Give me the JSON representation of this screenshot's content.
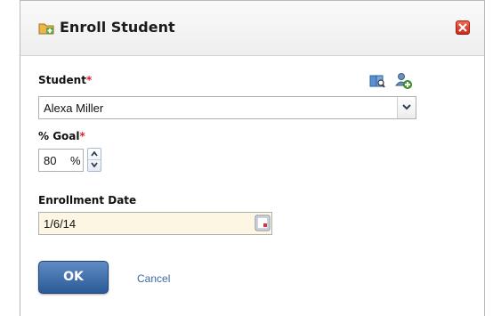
{
  "dialog": {
    "title": "Enroll Student",
    "title_icon": "enroll-folder-icon",
    "close_icon": "close-icon"
  },
  "form": {
    "student": {
      "label": "Student",
      "required_mark": "*",
      "selected_value": "Alexa Miller",
      "lookup_icon": "lookup-book-icon",
      "add_icon": "add-user-icon"
    },
    "goal": {
      "label": "% Goal",
      "required_mark": "*",
      "value": "80",
      "unit": "%"
    },
    "enrollment_date": {
      "label": "Enrollment Date",
      "value": "1/6/14",
      "calendar_icon": "calendar-icon"
    }
  },
  "buttons": {
    "ok_label": "OK",
    "cancel_label": "Cancel"
  },
  "colors": {
    "accent": "#2b5a98",
    "required": "#d9252a",
    "date_field_bg": "#fdf6e3",
    "link": "#3a6aa8"
  }
}
